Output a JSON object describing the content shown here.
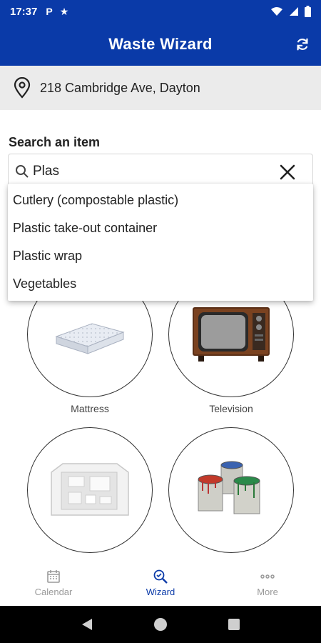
{
  "status_bar": {
    "time": "17:37",
    "notif_p": "P",
    "notif_star": "★"
  },
  "app_bar": {
    "title": "Waste Wizard",
    "refresh_icon": "refresh-icon"
  },
  "address": {
    "icon": "location-pin-icon",
    "text": "218 Cambridge Ave, Dayton"
  },
  "search": {
    "label": "Search an item",
    "value": "Plas",
    "search_icon": "search-icon",
    "clear_icon": "close-icon"
  },
  "suggestions": [
    "Cutlery (compostable plastic)",
    "Plastic take-out container",
    "Plastic wrap",
    "Vegetables"
  ],
  "items": [
    {
      "label": "Mattress",
      "icon": "mattress-image"
    },
    {
      "label": "Television",
      "icon": "television-image"
    },
    {
      "label": "",
      "icon": "styrofoam-packaging-image"
    },
    {
      "label": "",
      "icon": "paint-cans-image"
    }
  ],
  "bottom_nav": [
    {
      "label": "Calendar",
      "icon": "calendar-icon",
      "active": false
    },
    {
      "label": "Wizard",
      "icon": "wizard-search-icon",
      "active": true
    },
    {
      "label": "More",
      "icon": "more-dots-icon",
      "active": false
    }
  ],
  "colors": {
    "primary": "#0a3aa8",
    "address_bg": "#ebebeb",
    "nav_inactive": "#9a9a9a"
  }
}
